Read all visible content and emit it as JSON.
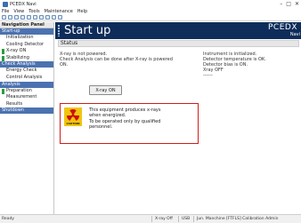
{
  "window": {
    "title": "PCEDX Navi",
    "controls": [
      "–",
      "□",
      "✕"
    ]
  },
  "menubar": {
    "items": [
      "File",
      "View",
      "Tools",
      "Maintenance",
      "Help"
    ]
  },
  "nav": {
    "header": "Navigation Panel",
    "sections": [
      {
        "label": "Start-up",
        "items": [
          {
            "label": "Initialization"
          },
          {
            "label": "Cooling Detector"
          },
          {
            "label": "X-ray ON",
            "active": true
          },
          {
            "label": "Stabilizing",
            "active": true
          }
        ]
      },
      {
        "label": "Check Analysis",
        "items": [
          {
            "label": "Energy Check"
          },
          {
            "label": "Control Analysis"
          }
        ]
      },
      {
        "label": "Analysis",
        "items": [
          {
            "label": "Preparation",
            "active": true
          },
          {
            "label": "Measurement"
          },
          {
            "label": "Results"
          }
        ]
      },
      {
        "label": "Shutdown",
        "items": []
      }
    ]
  },
  "main": {
    "heading": "Start up",
    "brand": "PCEDX",
    "subbrand": "Navi",
    "status_title": "Status",
    "left_lines": [
      "X-ray is not powered.",
      "Check Analysis can be done after X-ray is powered",
      "ON."
    ],
    "right_lines": [
      "Instrument is initialized.",
      "Detector temperature is OK.",
      "Detector bias is ON.",
      "Xray OFF",
      "------"
    ],
    "xray_button": "X-ray ON",
    "warning": {
      "sign_label": "CAUTION",
      "lines": [
        "This equipment produces x-rays",
        "when energized.",
        "To be operated only by qualified",
        "personnel."
      ]
    }
  },
  "statusbar": {
    "left": "Ready",
    "xray": "X-ray Off",
    "device": "USB",
    "user": "Jun. Manchine [FTFLS] Calibration Admin"
  }
}
